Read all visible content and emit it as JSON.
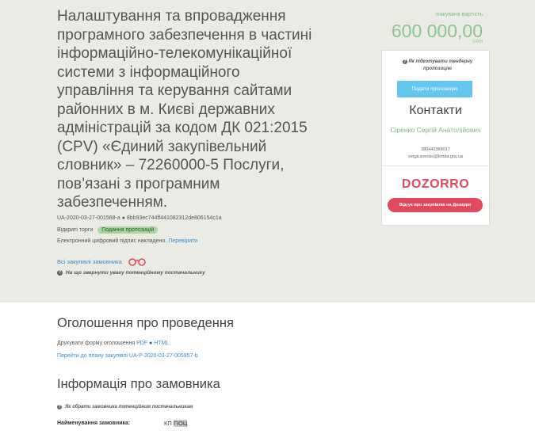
{
  "tender": {
    "title": "Налаштування та впровадження програмного забезпечення в частині інформаційно-телекомунікаційної системи з інформаційного управління та керування сайтами районних в м. Києві державних адміністрацій за кодом ДК 021:2015 (CPV) «Єдиний закупівельний словник» – 72260000-5 Послуги, пов’язані з програмним забезпеченням.",
    "id_line": "UA-2020-03-27-001568-a ● 8bb93ec744ff441082312de806154c1a",
    "type": "Відкриті торги",
    "status_badge": "Подання пропозицій",
    "signature_text": "Електронний цифровий підпис накладено.",
    "verify_link": "Перевірити",
    "all_buyer_purchases": "Всі закупівлі замовника",
    "attention_hint": "На що звернути увагу потенційному постачальнику"
  },
  "cost": {
    "label": "очікувана вартість",
    "value": "600 000,00",
    "currency": "UAH"
  },
  "card": {
    "prepare_hint": "Як підготувати тендерну пропозицію",
    "submit_button": "Подати пропозицію",
    "contacts_title": "Контакти",
    "contact_name": "Сіренко Сергій Анатолійович",
    "contact_phone": "380442388017",
    "contact_email": "sergii.sirenko@kmda.gov.ua",
    "dozorro_logo": "DOZORRO",
    "review_button": "Відгук про закупівлю на Дозорро"
  },
  "announcement": {
    "title": "Оголошення про проведення",
    "print_text": "Друкувати форму оголошення",
    "pdf": "PDF",
    "html": "HTML",
    "plan_link": "Перейти до плану закупівлі UA-P-2020-03-27-005957-b"
  },
  "buyer_info": {
    "title": "Інформація про замовника",
    "hint": "Як обрати замовника потенційним постачальникам",
    "name_label": "Найменування замовника:",
    "name_prefix": "КП",
    "name_highlight": "ГІОЦ"
  },
  "colors": {
    "hero_bg": "#e9ebe4",
    "accent_green": "#8cc68f",
    "offer_button": "#65c6ee",
    "dozorro_red": "#e04a5c",
    "link_blue": "#3a8bc9"
  }
}
